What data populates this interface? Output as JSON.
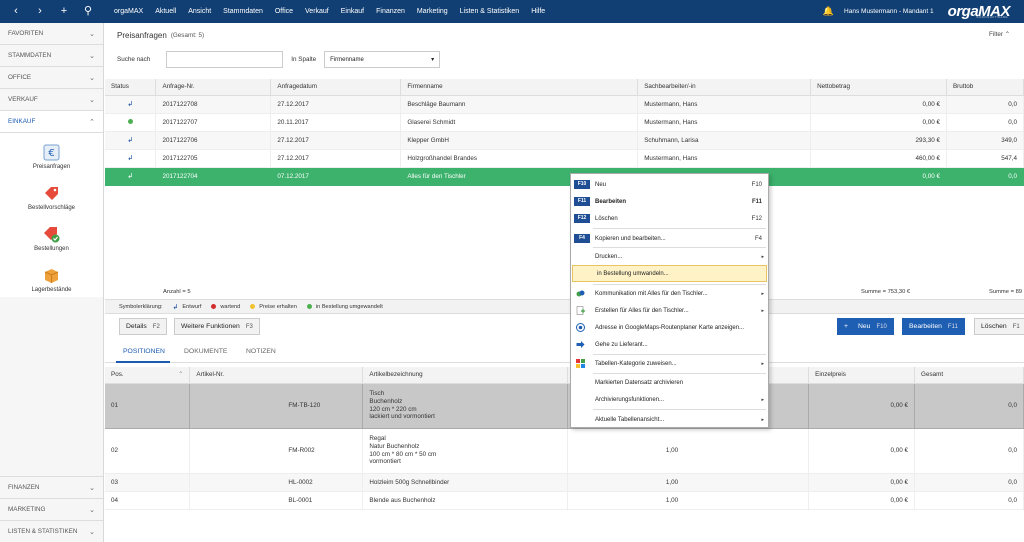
{
  "topbar": {
    "menu": [
      "orgaMAX",
      "Aktuell",
      "Ansicht",
      "Stammdaten",
      "Office",
      "Verkauf",
      "Einkauf",
      "Finanzen",
      "Marketing",
      "Listen & Statistiken",
      "Hilfe"
    ],
    "user": "Hans Mustermann - Mandant 1",
    "logo": "orgaMAX",
    "logo_sub": "BÜROSOFTWARE"
  },
  "sidebar": {
    "sections_top": [
      "FAVORITEN",
      "STAMMDATEN",
      "OFFICE",
      "VERKAUF",
      "EINKAUF"
    ],
    "tiles": [
      "Preisanfragen",
      "Bestellvorschläge",
      "Bestellungen",
      "Lagerbestände"
    ],
    "sections_bottom": [
      "FINANZEN",
      "MARKETING",
      "LISTEN & STATISTIKEN"
    ]
  },
  "main": {
    "title": "Preisanfragen",
    "count": "(Gesamt: 5)",
    "filter": "Filter",
    "search_label": "Suche nach",
    "search_value": "",
    "column_label": "In Spalte",
    "column_value": "Firmenname"
  },
  "grid1": {
    "headers": [
      "Status",
      "Anfrage-Nr.",
      "Anfragedatum",
      "Firmenname",
      "Sachbearbeiter/-in",
      "Nettobetrag",
      "Bruttob"
    ],
    "rows": [
      {
        "status": "arrow",
        "nr": "2017122708",
        "date": "27.12.2017",
        "firm": "Beschläge Baumann",
        "clerk": "Mustermann, Hans",
        "net": "0,00 €",
        "gross": "0,0"
      },
      {
        "status": "dot",
        "nr": "2017122707",
        "date": "20.11.2017",
        "firm": "Glaserei Schmidt",
        "clerk": "Mustermann, Hans",
        "net": "0,00 €",
        "gross": "0,0"
      },
      {
        "status": "arrow",
        "nr": "2017122706",
        "date": "27.12.2017",
        "firm": "Klepper GmbH",
        "clerk": "Schuhmann, Larisa",
        "net": "293,30 €",
        "gross": "349,0"
      },
      {
        "status": "arrow",
        "nr": "2017122705",
        "date": "27.12.2017",
        "firm": "Holzgroßhandel Brandes",
        "clerk": "Mustermann, Hans",
        "net": "460,00 €",
        "gross": "547,4"
      },
      {
        "status": "arrow",
        "nr": "2017122704",
        "date": "07.12.2017",
        "firm": "Alles für den Tischler",
        "clerk": "",
        "net": "0,00 €",
        "gross": "0,0"
      }
    ],
    "anzahl": "Anzahl = 5",
    "sum_net": "Summe = 753,30 €",
    "sum_gross": "Summe = 89"
  },
  "legend": {
    "label": "Symbolerklärung:",
    "items": [
      {
        "label": "Entwurf",
        "color": "#1a4fa0"
      },
      {
        "label": "wartend",
        "color": "#d32f2f"
      },
      {
        "label": "Preise erhalten",
        "color": "#f2c12e"
      },
      {
        "label": "in Bestellung umgewandelt",
        "color": "#4caf50"
      }
    ]
  },
  "buttons": {
    "details": "Details",
    "details_key": "F2",
    "more": "Weitere Funktionen",
    "more_key": "F3",
    "new": "Neu",
    "new_key": "F10",
    "edit": "Bearbeiten",
    "edit_key": "F11",
    "delete": "Löschen",
    "delete_key": "F1"
  },
  "tabs": [
    "POSITIONEN",
    "DOKUMENTE",
    "NOTIZEN"
  ],
  "grid2": {
    "headers": [
      "Pos.",
      "Artikel-Nr.",
      "Artikelbezeichnung",
      "",
      "Einzelpreis",
      "Gesamt"
    ],
    "rows": [
      {
        "pos": "01",
        "art": "FM-TB-120",
        "desc": [
          "Tisch",
          "Buchenholz",
          "120 cm * 220 cm",
          "lackiert und vormontiert"
        ],
        "qty": "",
        "price": "0,00 €",
        "total": "0,0"
      },
      {
        "pos": "02",
        "art": "FM-R002",
        "desc": [
          "Regal",
          "Natur Buchenholz",
          "100 cm * 80 cm * 50 cm",
          "vormontiert"
        ],
        "qty": "1,00",
        "price": "0,00 €",
        "total": "0,0"
      },
      {
        "pos": "03",
        "art": "HL-0002",
        "desc": [
          "Holzleim 500g Schnellbinder"
        ],
        "qty": "1,00",
        "price": "0,00 €",
        "total": "0,0"
      },
      {
        "pos": "04",
        "art": "BL-0001",
        "desc": [
          "Blende aus Buchenholz"
        ],
        "qty": "1,00",
        "price": "0,00 €",
        "total": "0,0"
      }
    ]
  },
  "context_menu": {
    "items": [
      {
        "key": "F10",
        "label": "Neu",
        "sc": "F10"
      },
      {
        "key": "F11",
        "label": "Bearbeiten",
        "sc": "F11"
      },
      {
        "key": "F12",
        "label": "Löschen",
        "sc": "F12"
      },
      {
        "key": "F4",
        "label": "Kopieren und bearbeiten...",
        "sc": "F4"
      },
      {
        "label": "Drucken..."
      },
      {
        "label": "in Bestellung umwandeln..."
      },
      {
        "label": "Kommunikation mit Alles für den Tischler..."
      },
      {
        "label": "Erstellen für Alles für den Tischler..."
      },
      {
        "label": "Adresse in GoogleMaps-Routenplaner Karte anzeigen..."
      },
      {
        "label": "Gehe zu Lieferant..."
      },
      {
        "label": "Tabellen-Kategorie zuweisen..."
      },
      {
        "label": "Markierten Datensatz archivieren"
      },
      {
        "label": "Archivierungsfunktionen..."
      },
      {
        "label": "Aktuelle Tabellenansicht..."
      }
    ]
  }
}
